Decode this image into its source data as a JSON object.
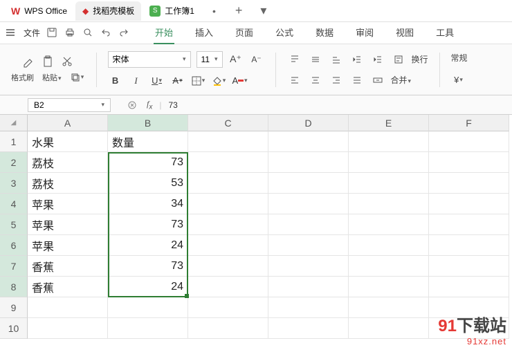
{
  "tabs": {
    "app": "WPS Office",
    "doc1": "找稻壳模板",
    "doc2": "工作簿1"
  },
  "menu": {
    "file": "文件",
    "items": [
      "开始",
      "插入",
      "页面",
      "公式",
      "数据",
      "审阅",
      "视图",
      "工具"
    ]
  },
  "ribbon": {
    "format_brush": "格式刷",
    "paste": "粘贴",
    "font_name": "宋体",
    "font_size": "11",
    "wrap": "换行",
    "merge": "合并",
    "style": "常规"
  },
  "formula": {
    "cell_ref": "B2",
    "value": "73"
  },
  "columns": [
    "A",
    "B",
    "C",
    "D",
    "E",
    "F"
  ],
  "rows": [
    "1",
    "2",
    "3",
    "4",
    "5",
    "6",
    "7",
    "8",
    "9",
    "10"
  ],
  "cells": {
    "A1": "水果",
    "B1": "数量",
    "A2": "荔枝",
    "B2": "73",
    "A3": "荔枝",
    "B3": "53",
    "A4": "苹果",
    "B4": "34",
    "A5": "苹果",
    "B5": "73",
    "A6": "苹果",
    "B6": "24",
    "A7": "香蕉",
    "B7": "73",
    "A8": "香蕉",
    "B8": "24"
  },
  "watermark": {
    "main_num": "91",
    "main_txt": "下载站",
    "sub": "91xz.net"
  },
  "chart_data": {
    "type": "table",
    "columns": [
      "水果",
      "数量"
    ],
    "rows": [
      [
        "荔枝",
        73
      ],
      [
        "荔枝",
        53
      ],
      [
        "苹果",
        34
      ],
      [
        "苹果",
        73
      ],
      [
        "苹果",
        24
      ],
      [
        "香蕉",
        73
      ],
      [
        "香蕉",
        24
      ]
    ]
  }
}
